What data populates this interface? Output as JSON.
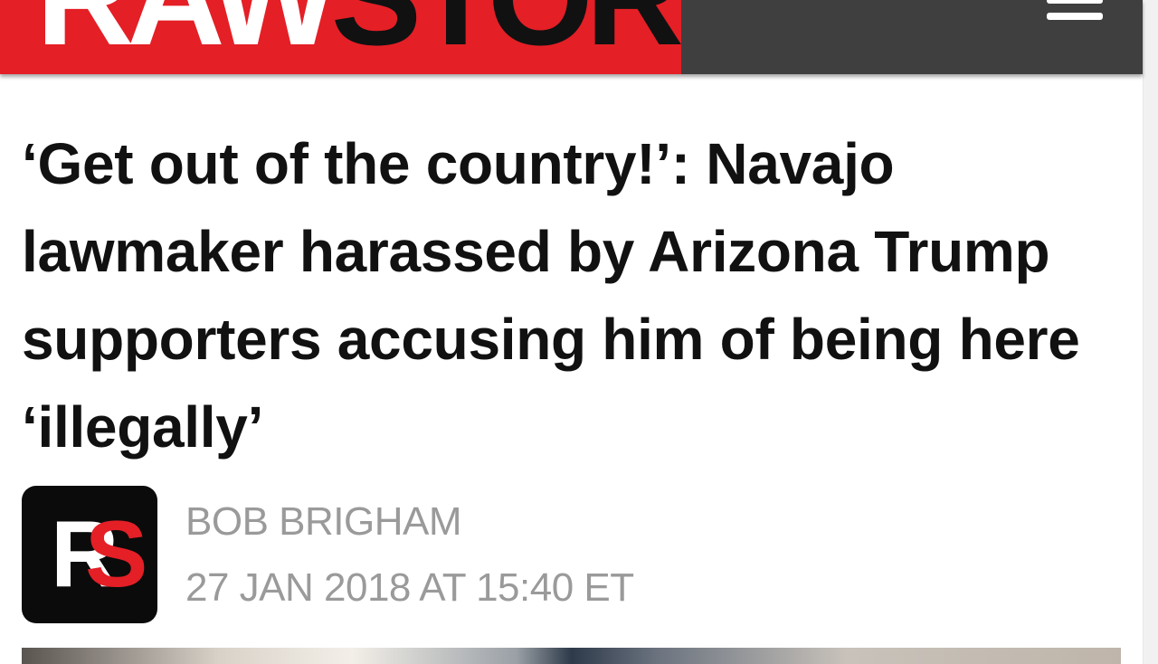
{
  "header": {
    "logo_raw": "RAW",
    "logo_story": "STORY",
    "menu_icon": "hamburger-menu-icon",
    "colors": {
      "brand_red": "#e41f26",
      "header_bg": "#3f3f3f"
    }
  },
  "article": {
    "headline": "‘Get out of the country!’: Navajo lawmaker harassed by Arizona Trump supporters accusing him of being here ‘illegally’",
    "author": "BOB BRIGHAM",
    "date": "27 JAN 2018 AT 15:40 ET",
    "avatar": {
      "letter_r": "R",
      "letter_s": "S"
    }
  }
}
